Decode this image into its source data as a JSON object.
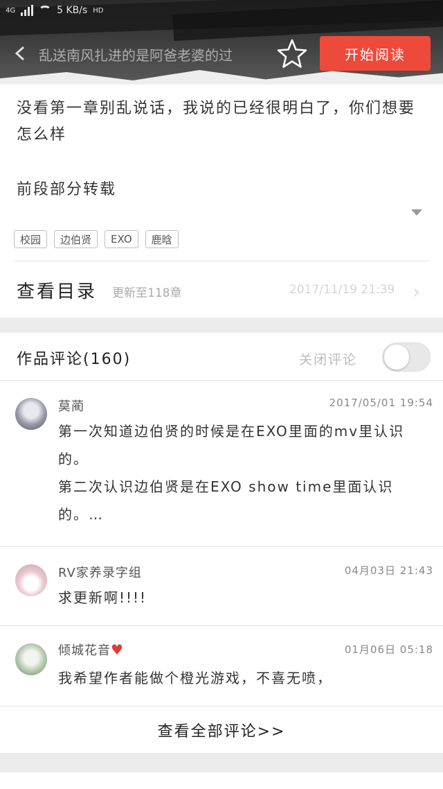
{
  "status_bar": {
    "network": "4G",
    "speed": "5 KB/s",
    "extra": "HD"
  },
  "header": {
    "title": "乱送南风扎进的是阿爸老婆的过",
    "start_reading_label": "开始阅读"
  },
  "intro": {
    "line1": "没看第一章别乱说话，我说的已经很明白了，你们想要怎么样",
    "line2": "前段部分转载"
  },
  "tags": [
    "校园",
    "边伯贤",
    "EXO",
    "鹿晗"
  ],
  "toc": {
    "label": "查看目录",
    "update": "更新至118章",
    "date": "2017/11/19 21:39"
  },
  "comments_section": {
    "title": "作品评论(160)",
    "close_label": "关闭评论",
    "toggle_on": false,
    "view_all": "查看全部评论>>",
    "items": [
      {
        "name": "莫蔺",
        "time": "2017/05/01 19:54",
        "text": "第一次知道边伯贤的时候是在EXO里面的mv里认识的。\n第二次认识边伯贤是在EXO show time里面认识的。…"
      },
      {
        "name": "RV家养录字组",
        "time": "04月03日 21:43",
        "text": "求更新啊!!!!"
      },
      {
        "name": "倾城花音",
        "time": "01月06日 05:18",
        "text": "我希望作者能做个橙光游戏，不喜无喷，"
      }
    ]
  },
  "colors": {
    "accent": "#ee4a3c",
    "heart": "#e53935"
  }
}
